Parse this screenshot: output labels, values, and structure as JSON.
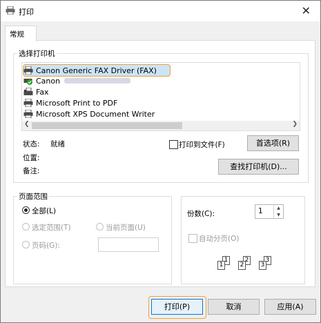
{
  "window": {
    "title": "打印",
    "close_glyph": "✕"
  },
  "tabs": [
    {
      "label": "常规"
    }
  ],
  "select_printer": {
    "group_label": "选择打印机",
    "printers": [
      {
        "name": "Canon Generic FAX Driver (FAX)",
        "icon": "printer-icon",
        "selected": true
      },
      {
        "name": "Canon",
        "icon": "default-printer-check-icon",
        "selected": false,
        "note": "name partially obscured"
      },
      {
        "name": "Fax",
        "icon": "fax-icon",
        "selected": false
      },
      {
        "name": "Microsoft Print to PDF",
        "icon": "printer-icon",
        "selected": false
      },
      {
        "name": "Microsoft XPS Document Writer",
        "icon": "printer-icon",
        "selected": false
      }
    ],
    "status_label": "状态:",
    "status_value": "就绪",
    "location_label": "位置:",
    "comment_label": "备注:",
    "print_to_file_label": "打印到文件(F)",
    "preferences_button": "首选项(R)",
    "find_printer_button": "查找打印机(D)..."
  },
  "page_range": {
    "group_label": "页面范围",
    "all_label": "全部(L)",
    "selection_label": "选定范围(T)",
    "current_page_label": "当前页面(U)",
    "pages_label": "页码(G):",
    "pages_value": ""
  },
  "copies": {
    "copies_label": "份数(C):",
    "copies_value": "1",
    "collate_label": "自动分页(O)",
    "collate_pages": [
      "1",
      "1",
      "2",
      "2",
      "3",
      "3"
    ]
  },
  "footer": {
    "print_button": "打印(P)",
    "cancel_button": "取消",
    "apply_button": "应用(A)"
  },
  "colors": {
    "accent": "#0078d7",
    "focus": "#f0a030",
    "selection": "#cce4f7"
  }
}
